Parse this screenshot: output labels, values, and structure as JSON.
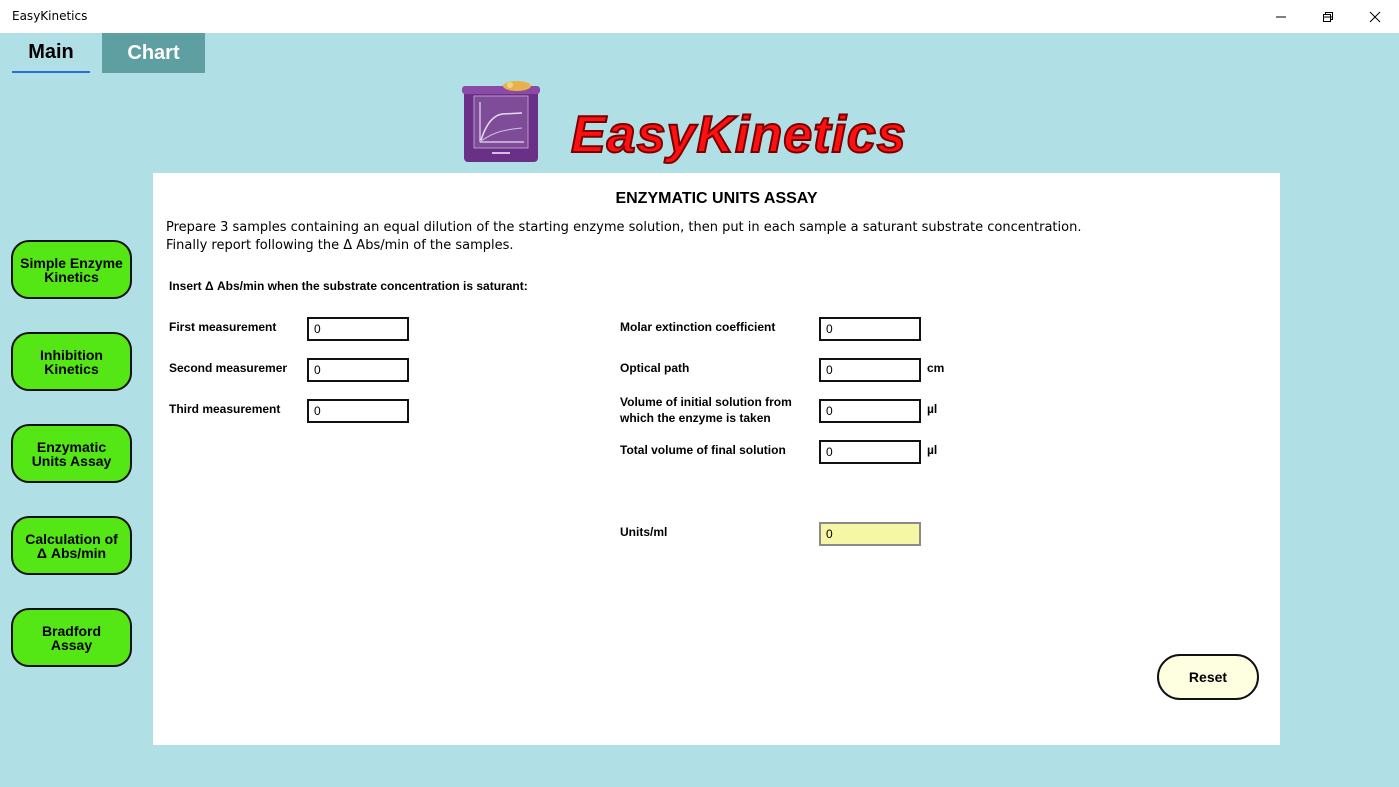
{
  "window": {
    "title": "EasyKinetics"
  },
  "tabs": [
    {
      "label": "Main"
    },
    {
      "label": "Chart"
    }
  ],
  "logo": {
    "text": "EasyKinetics"
  },
  "sidebar": {
    "items": [
      {
        "label": "Simple Enzyme Kinetics"
      },
      {
        "label": "Inhibition Kinetics"
      },
      {
        "label": "Enzymatic Units Assay"
      },
      {
        "label": "Calculation of Δ Abs/min"
      },
      {
        "label": "Bradford Assay"
      }
    ]
  },
  "panel": {
    "title": "ENZYMATIC UNITS ASSAY",
    "description_line1": "Prepare 3 samples containing an equal dilution of the starting enzyme solution, then put in each sample a saturant substrate concentration.",
    "description_line2": "Finally report following the Δ Abs/min of the samples.",
    "insert_label": "Insert Δ Abs/min when the substrate concentration is saturant:",
    "measurements": [
      {
        "label": "First measurement",
        "value": "0"
      },
      {
        "label": "Second measuremen",
        "value": "0"
      },
      {
        "label": "Third measurement",
        "value": "0"
      }
    ],
    "parameters": [
      {
        "label": "Molar extinction coefficient",
        "value": "0",
        "unit": ""
      },
      {
        "label": "Optical path",
        "value": "0",
        "unit": "cm"
      },
      {
        "label": "Volume of initial solution from which the enzyme is taken",
        "value": "0",
        "unit": "µl"
      },
      {
        "label": "Total volume of final solution",
        "value": "0",
        "unit": "µl"
      }
    ],
    "result": {
      "label": "Units/ml",
      "value": "0"
    },
    "reset_label": "Reset"
  },
  "colors": {
    "background": "#b0dfe5",
    "sidebar_button": "#55e615",
    "chart_tab": "#5e9fa1",
    "result_field": "#f5f7a5",
    "reset_button": "#fefee0",
    "logo_red": "#ff1010"
  }
}
